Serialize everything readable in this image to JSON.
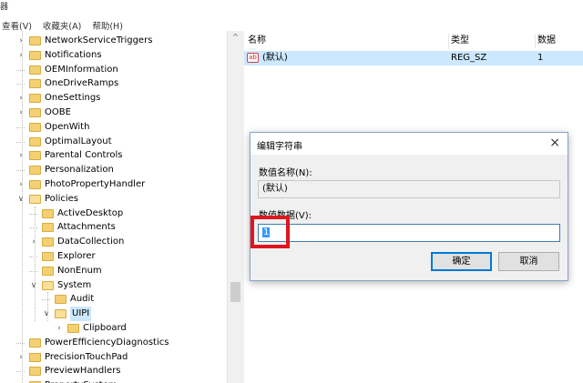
{
  "menubar": {
    "fragment": "器",
    "items": [
      "查看(V)",
      "收藏夹(A)",
      "帮助(H)"
    ]
  },
  "tree": {
    "items": [
      {
        "label": "NetworkServiceTriggers",
        "level": 0,
        "expander": "collapsed"
      },
      {
        "label": "Notifications",
        "level": 0,
        "expander": "collapsed"
      },
      {
        "label": "OEMInformation",
        "level": 0,
        "expander": "none"
      },
      {
        "label": "OneDriveRamps",
        "level": 0,
        "expander": "none"
      },
      {
        "label": "OneSettings",
        "level": 0,
        "expander": "collapsed"
      },
      {
        "label": "OOBE",
        "level": 0,
        "expander": "collapsed"
      },
      {
        "label": "OpenWith",
        "level": 0,
        "expander": "none"
      },
      {
        "label": "OptimalLayout",
        "level": 0,
        "expander": "none"
      },
      {
        "label": "Parental Controls",
        "level": 0,
        "expander": "collapsed"
      },
      {
        "label": "Personalization",
        "level": 0,
        "expander": "none"
      },
      {
        "label": "PhotoPropertyHandler",
        "level": 0,
        "expander": "collapsed"
      },
      {
        "label": "Policies",
        "level": 0,
        "expander": "expanded"
      },
      {
        "label": "ActiveDesktop",
        "level": 1,
        "expander": "none"
      },
      {
        "label": "Attachments",
        "level": 1,
        "expander": "none"
      },
      {
        "label": "DataCollection",
        "level": 1,
        "expander": "collapsed"
      },
      {
        "label": "Explorer",
        "level": 1,
        "expander": "none"
      },
      {
        "label": "NonEnum",
        "level": 1,
        "expander": "none"
      },
      {
        "label": "System",
        "level": 1,
        "expander": "expanded"
      },
      {
        "label": "Audit",
        "level": 2,
        "expander": "none"
      },
      {
        "label": "UIPI",
        "level": 2,
        "expander": "expanded",
        "selected": true
      },
      {
        "label": "Clipboard",
        "level": 3,
        "expander": "collapsed"
      },
      {
        "label": "PowerEfficiencyDiagnostics",
        "level": 0,
        "expander": "none"
      },
      {
        "label": "PrecisionTouchPad",
        "level": 0,
        "expander": "collapsed"
      },
      {
        "label": "PreviewHandlers",
        "level": 0,
        "expander": "none"
      },
      {
        "label": "PropertySystem",
        "level": 0,
        "expander": "collapsed"
      }
    ]
  },
  "list": {
    "columns": [
      "名称",
      "类型",
      "数据"
    ],
    "rows": [
      {
        "name": "(默认)",
        "type": "REG_SZ",
        "data": "1",
        "icon": "ab"
      }
    ]
  },
  "dialog": {
    "title": "编辑字符串",
    "close": "×",
    "name_label": "数值名称(N):",
    "name_value": "(默认)",
    "data_label": "数值数据(V):",
    "data_value": "1",
    "ok_label": "确定",
    "cancel_label": "取消"
  },
  "colors": {
    "selection": "#cce8ff",
    "highlight_box": "#e0161d",
    "text_selection": "#3399ff"
  },
  "scrollbar": {
    "up_arrow": "^"
  }
}
